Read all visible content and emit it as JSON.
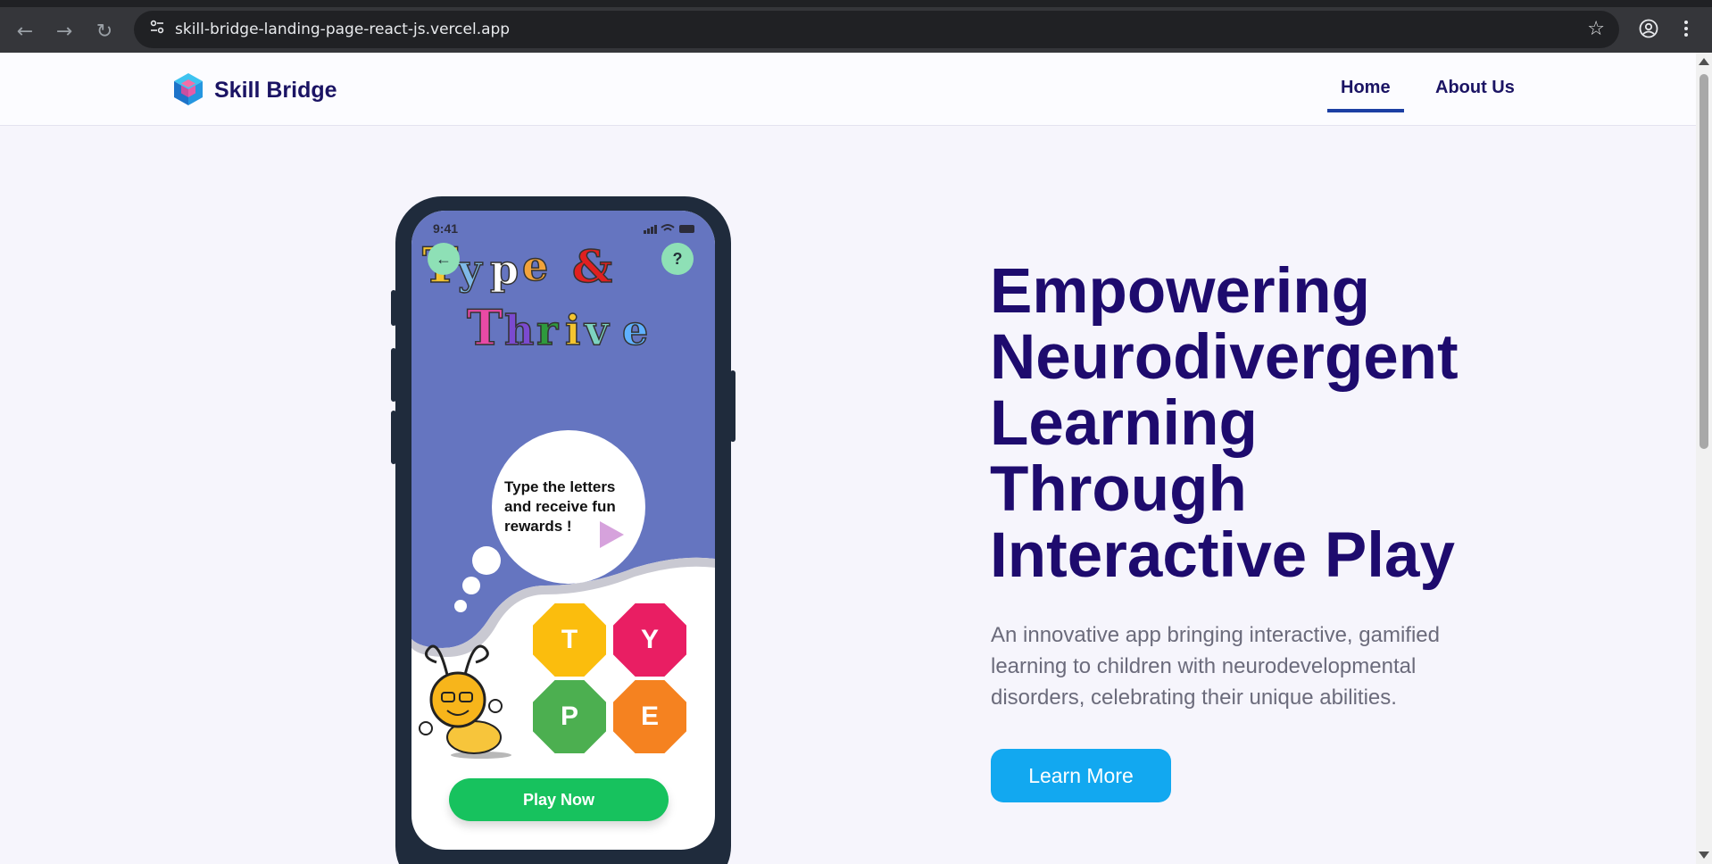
{
  "browser": {
    "url": "skill-bridge-landing-page-react-js.vercel.app"
  },
  "header": {
    "brand": "Skill Bridge",
    "nav": {
      "home": "Home",
      "about": "About Us"
    },
    "active_nav": "Home"
  },
  "hero": {
    "title_lines": [
      "Empowering",
      "Neurodivergent",
      "Learning",
      "Through",
      "Interactive Play"
    ],
    "description": "An innovative app bringing interactive, gamified learning to children with neurodevelopmental disorders, celebrating their unique abilities.",
    "cta_label": "Learn More"
  },
  "phone": {
    "time": "9:41",
    "back_icon": "arrow-left-icon",
    "help_label": "?",
    "game_title_line1": "Type &",
    "game_title_line2": "Thrive",
    "bubble_text": "Type the letters and receive fun rewards !",
    "letters": [
      {
        "letter": "T",
        "color": "#fbbd0d"
      },
      {
        "letter": "Y",
        "color": "#e91e63"
      },
      {
        "letter": "P",
        "color": "#4caf50"
      },
      {
        "letter": "E",
        "color": "#f58220"
      }
    ],
    "play_label": "Play Now"
  },
  "colors": {
    "brand_dark": "#1e0b6e",
    "cta": "#12a8f0",
    "play": "#17c25e",
    "screen_purple": "#6575c0"
  }
}
